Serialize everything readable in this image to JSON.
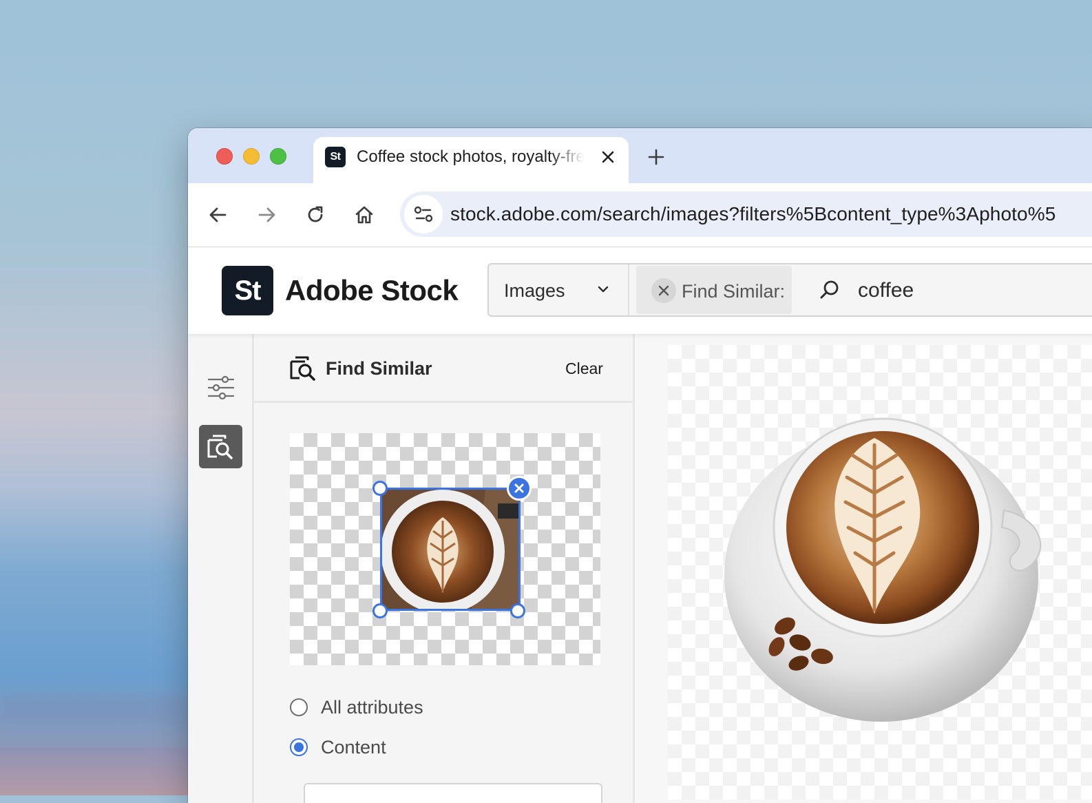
{
  "browser": {
    "tab": {
      "favicon_text": "St",
      "title": "Coffee stock photos, royalty-free images"
    },
    "address": {
      "url": "stock.adobe.com/search/images?filters%5Bcontent_type%3Aphoto%5"
    }
  },
  "header": {
    "logo_mark": "St",
    "logo_text": "Adobe Stock",
    "search": {
      "type_selected": "Images",
      "chip_label": "Find Similar:",
      "query": "coffee"
    }
  },
  "find_similar_panel": {
    "title": "Find Similar",
    "clear_label": "Clear",
    "options": [
      {
        "label": "All attributes",
        "checked": false
      },
      {
        "label": "Content",
        "checked": true
      }
    ]
  },
  "colors": {
    "accent": "#3b74e0",
    "brand_dark": "#131c26",
    "tabstrip": "#d9e3f7"
  },
  "icons": {
    "filters": "sliders-icon",
    "find_similar": "image-search-icon",
    "search": "magnifier-icon"
  }
}
